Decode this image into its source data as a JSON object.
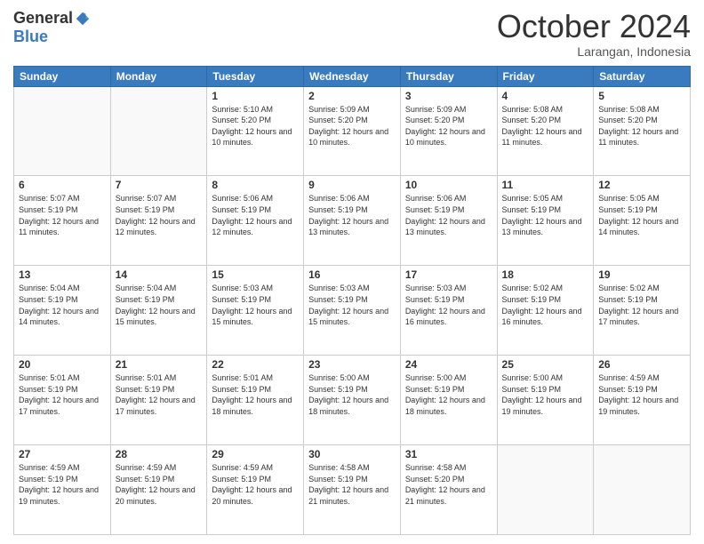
{
  "logo": {
    "general": "General",
    "blue": "Blue"
  },
  "title": "October 2024",
  "location": "Larangan, Indonesia",
  "days_header": [
    "Sunday",
    "Monday",
    "Tuesday",
    "Wednesday",
    "Thursday",
    "Friday",
    "Saturday"
  ],
  "weeks": [
    [
      {
        "day": "",
        "empty": true
      },
      {
        "day": "",
        "empty": true
      },
      {
        "day": "1",
        "sunrise": "5:10 AM",
        "sunset": "5:20 PM",
        "daylight": "12 hours and 10 minutes."
      },
      {
        "day": "2",
        "sunrise": "5:09 AM",
        "sunset": "5:20 PM",
        "daylight": "12 hours and 10 minutes."
      },
      {
        "day": "3",
        "sunrise": "5:09 AM",
        "sunset": "5:20 PM",
        "daylight": "12 hours and 10 minutes."
      },
      {
        "day": "4",
        "sunrise": "5:08 AM",
        "sunset": "5:20 PM",
        "daylight": "12 hours and 11 minutes."
      },
      {
        "day": "5",
        "sunrise": "5:08 AM",
        "sunset": "5:20 PM",
        "daylight": "12 hours and 11 minutes."
      }
    ],
    [
      {
        "day": "6",
        "sunrise": "5:07 AM",
        "sunset": "5:19 PM",
        "daylight": "12 hours and 11 minutes."
      },
      {
        "day": "7",
        "sunrise": "5:07 AM",
        "sunset": "5:19 PM",
        "daylight": "12 hours and 12 minutes."
      },
      {
        "day": "8",
        "sunrise": "5:06 AM",
        "sunset": "5:19 PM",
        "daylight": "12 hours and 12 minutes."
      },
      {
        "day": "9",
        "sunrise": "5:06 AM",
        "sunset": "5:19 PM",
        "daylight": "12 hours and 13 minutes."
      },
      {
        "day": "10",
        "sunrise": "5:06 AM",
        "sunset": "5:19 PM",
        "daylight": "12 hours and 13 minutes."
      },
      {
        "day": "11",
        "sunrise": "5:05 AM",
        "sunset": "5:19 PM",
        "daylight": "12 hours and 13 minutes."
      },
      {
        "day": "12",
        "sunrise": "5:05 AM",
        "sunset": "5:19 PM",
        "daylight": "12 hours and 14 minutes."
      }
    ],
    [
      {
        "day": "13",
        "sunrise": "5:04 AM",
        "sunset": "5:19 PM",
        "daylight": "12 hours and 14 minutes."
      },
      {
        "day": "14",
        "sunrise": "5:04 AM",
        "sunset": "5:19 PM",
        "daylight": "12 hours and 15 minutes."
      },
      {
        "day": "15",
        "sunrise": "5:03 AM",
        "sunset": "5:19 PM",
        "daylight": "12 hours and 15 minutes."
      },
      {
        "day": "16",
        "sunrise": "5:03 AM",
        "sunset": "5:19 PM",
        "daylight": "12 hours and 15 minutes."
      },
      {
        "day": "17",
        "sunrise": "5:03 AM",
        "sunset": "5:19 PM",
        "daylight": "12 hours and 16 minutes."
      },
      {
        "day": "18",
        "sunrise": "5:02 AM",
        "sunset": "5:19 PM",
        "daylight": "12 hours and 16 minutes."
      },
      {
        "day": "19",
        "sunrise": "5:02 AM",
        "sunset": "5:19 PM",
        "daylight": "12 hours and 17 minutes."
      }
    ],
    [
      {
        "day": "20",
        "sunrise": "5:01 AM",
        "sunset": "5:19 PM",
        "daylight": "12 hours and 17 minutes."
      },
      {
        "day": "21",
        "sunrise": "5:01 AM",
        "sunset": "5:19 PM",
        "daylight": "12 hours and 17 minutes."
      },
      {
        "day": "22",
        "sunrise": "5:01 AM",
        "sunset": "5:19 PM",
        "daylight": "12 hours and 18 minutes."
      },
      {
        "day": "23",
        "sunrise": "5:00 AM",
        "sunset": "5:19 PM",
        "daylight": "12 hours and 18 minutes."
      },
      {
        "day": "24",
        "sunrise": "5:00 AM",
        "sunset": "5:19 PM",
        "daylight": "12 hours and 18 minutes."
      },
      {
        "day": "25",
        "sunrise": "5:00 AM",
        "sunset": "5:19 PM",
        "daylight": "12 hours and 19 minutes."
      },
      {
        "day": "26",
        "sunrise": "4:59 AM",
        "sunset": "5:19 PM",
        "daylight": "12 hours and 19 minutes."
      }
    ],
    [
      {
        "day": "27",
        "sunrise": "4:59 AM",
        "sunset": "5:19 PM",
        "daylight": "12 hours and 19 minutes."
      },
      {
        "day": "28",
        "sunrise": "4:59 AM",
        "sunset": "5:19 PM",
        "daylight": "12 hours and 20 minutes."
      },
      {
        "day": "29",
        "sunrise": "4:59 AM",
        "sunset": "5:19 PM",
        "daylight": "12 hours and 20 minutes."
      },
      {
        "day": "30",
        "sunrise": "4:58 AM",
        "sunset": "5:19 PM",
        "daylight": "12 hours and 21 minutes."
      },
      {
        "day": "31",
        "sunrise": "4:58 AM",
        "sunset": "5:20 PM",
        "daylight": "12 hours and 21 minutes."
      },
      {
        "day": "",
        "empty": true
      },
      {
        "day": "",
        "empty": true
      }
    ]
  ],
  "labels": {
    "sunrise": "Sunrise:",
    "sunset": "Sunset:",
    "daylight": "Daylight:"
  }
}
